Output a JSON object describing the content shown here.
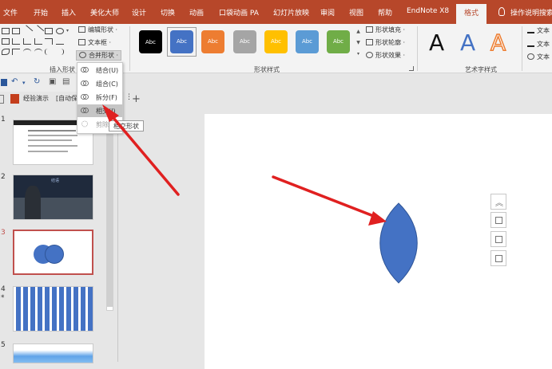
{
  "menu": {
    "tabs": [
      "文件",
      "开始",
      "插入",
      "美化大师",
      "设计",
      "切换",
      "动画",
      "口袋动画 PA",
      "幻灯片放映",
      "审阅",
      "视图",
      "帮助",
      "EndNote X8"
    ],
    "active_tab": "格式",
    "tell_me": "操作说明搜索"
  },
  "ribbon": {
    "insert_shapes_label": "插入形状",
    "edit_shape": "编辑形状 ·",
    "text_box": "文本框 ·",
    "merge_shapes": "合并形状 ·",
    "shape_styles_label": "形状样式",
    "style_swatch_text": "Abc",
    "style_colors": [
      "#000000",
      "#4472c4",
      "#ed7d31",
      "#a5a5a5",
      "#ffc000",
      "#5b9bd5",
      "#70ad47"
    ],
    "fill": "形状填充 ·",
    "outline": "形状轮廓 ·",
    "effects": "形状效果 ·",
    "wordart_label": "艺术字样式",
    "wordart_letter": "A",
    "text_fill": "文本",
    "text_outline": "文本",
    "text_effects": "文本"
  },
  "doc_tabs": {
    "tab1": "经验演示",
    "tab2": "[自动保"
  },
  "dropdown": {
    "items": [
      {
        "label": "结合(U)",
        "state": "normal"
      },
      {
        "label": "组合(C)",
        "state": "normal"
      },
      {
        "label": "拆分(F)",
        "state": "normal"
      },
      {
        "label": "相交(I)",
        "state": "highlighted"
      },
      {
        "label": "剪除",
        "state": "normal"
      }
    ]
  },
  "tooltip": "相交形状",
  "slides": [
    {
      "number": "1",
      "selected": false
    },
    {
      "number": "2",
      "selected": false
    },
    {
      "number": "3",
      "selected": true
    },
    {
      "number": "4",
      "selected": false,
      "star": "*"
    },
    {
      "number": "5",
      "selected": false
    }
  ],
  "thumb2_text": "结语",
  "colors": {
    "accent": "#b7472a",
    "shape_fill": "#4472c4",
    "arrow": "#e02020"
  }
}
